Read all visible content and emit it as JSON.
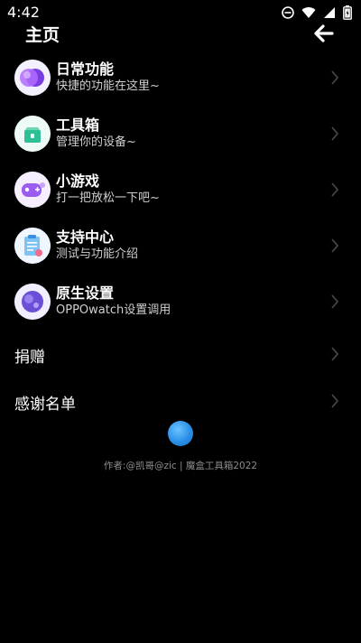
{
  "status_bar": {
    "time": "4:42",
    "icons": [
      "do-not-disturb-icon",
      "wifi-icon",
      "signal-icon",
      "battery-icon"
    ]
  },
  "header": {
    "title": "主页",
    "back_icon": "back-arrow-icon"
  },
  "menu": {
    "items": [
      {
        "title": "日常功能",
        "subtitle": "快捷的功能在这里~",
        "icon": "purple-orbs-icon"
      },
      {
        "title": "工具箱",
        "subtitle": "管理你的设备~",
        "icon": "toolbox-icon"
      },
      {
        "title": "小游戏",
        "subtitle": "打一把放松一下吧~",
        "icon": "gamepad-icon"
      },
      {
        "title": "支持中心",
        "subtitle": "测试与功能介绍",
        "icon": "clipboard-icon"
      },
      {
        "title": "原生设置",
        "subtitle": "OPPOwatch设置调用",
        "icon": "settings-blob-icon"
      }
    ],
    "plain_items": [
      {
        "label": "捐赠"
      },
      {
        "label": "感谢名单"
      }
    ]
  },
  "footer": {
    "credit": "作者:@凯哥@zic | 魔盒工具箱2022"
  },
  "colors": {
    "background": "#000000",
    "text_primary": "#ffffff",
    "text_secondary": "#cfcfcf",
    "footer_text": "#8c8c8c",
    "chevron": "#4a4a4a"
  }
}
